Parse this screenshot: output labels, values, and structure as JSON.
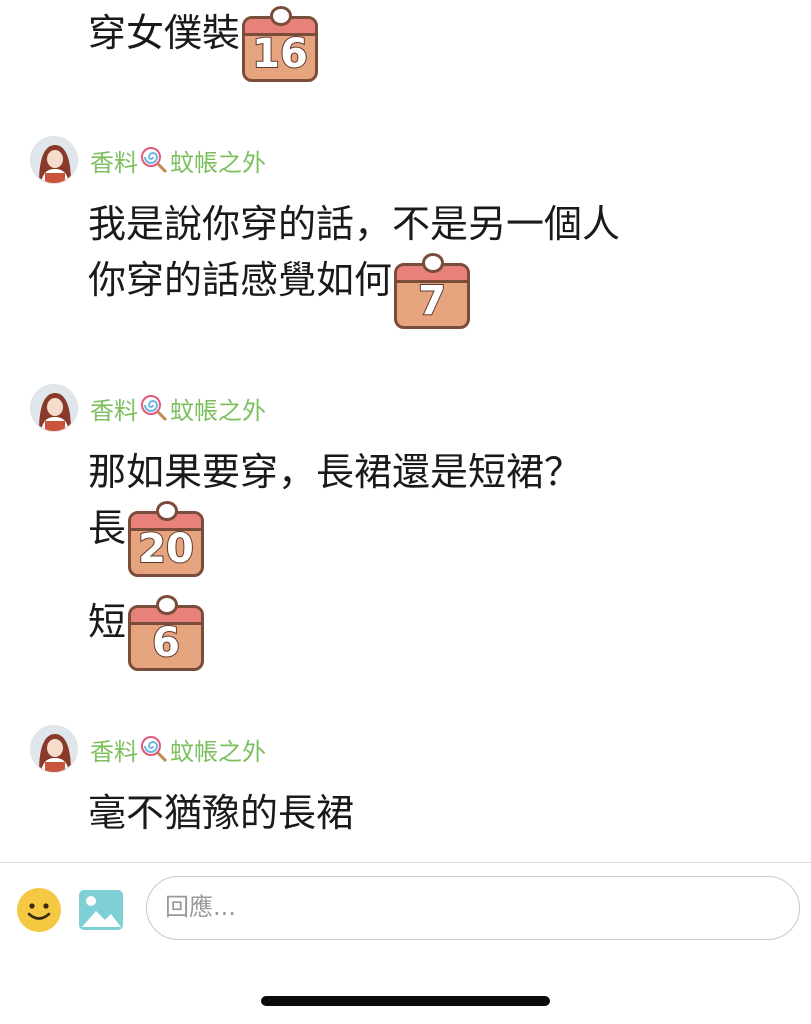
{
  "messages": [
    {
      "lines": [
        {
          "text": "穿女僕裝",
          "badge": "16"
        }
      ]
    },
    {
      "author": {
        "name_prefix": "香料",
        "name_suffix": "蚊帳之外"
      },
      "lines": [
        {
          "text": "我是說你穿的話，不是另一個人"
        },
        {
          "text": "你穿的話感覺如何",
          "badge": "7"
        }
      ]
    },
    {
      "author": {
        "name_prefix": "香料",
        "name_suffix": "蚊帳之外"
      },
      "lines": [
        {
          "text": "那如果要穿，長裙還是短裙？"
        },
        {
          "text": "長",
          "badge": "20"
        },
        {
          "text": "短",
          "badge": "6"
        }
      ]
    },
    {
      "author": {
        "name_prefix": "香料",
        "name_suffix": "蚊帳之外"
      },
      "lines": [
        {
          "text": "毫不猶豫的長裙"
        }
      ]
    }
  ],
  "composer": {
    "placeholder": "回應..."
  },
  "icons": {
    "emoji": "smiley-icon",
    "image": "image-icon",
    "candy": "lollipop-icon",
    "badge": "calendar-icon"
  },
  "colors": {
    "author_name": "#7cc05e",
    "badge_fill": "#e6a47e",
    "badge_top": "#e7817a",
    "emoji": "#f5c842",
    "image_icon": "#7fd0d6"
  }
}
